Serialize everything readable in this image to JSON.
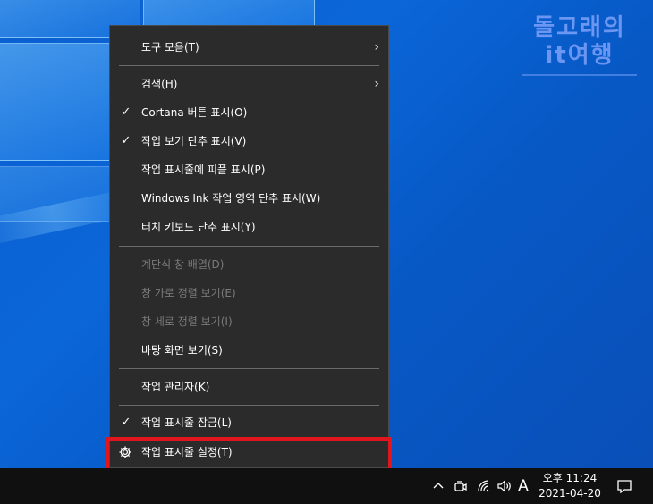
{
  "desktop": {
    "watermark_line1": "돌고래의",
    "watermark_line2": "it여행"
  },
  "menu": {
    "items": [
      {
        "label": "도구 모음(T)",
        "checked": false,
        "submenu": true,
        "disabled": false
      },
      {
        "label": "검색(H)",
        "checked": false,
        "submenu": true,
        "disabled": false
      },
      {
        "label": "Cortana 버튼 표시(O)",
        "checked": true,
        "submenu": false,
        "disabled": false
      },
      {
        "label": "작업 보기 단추 표시(V)",
        "checked": true,
        "submenu": false,
        "disabled": false
      },
      {
        "label": "작업 표시줄에 피플 표시(P)",
        "checked": false,
        "submenu": false,
        "disabled": false
      },
      {
        "label": "Windows Ink 작업 영역 단추 표시(W)",
        "checked": false,
        "submenu": false,
        "disabled": false
      },
      {
        "label": "터치 키보드 단추 표시(Y)",
        "checked": false,
        "submenu": false,
        "disabled": false
      },
      {
        "label": "계단식 창 배열(D)",
        "checked": false,
        "submenu": false,
        "disabled": true
      },
      {
        "label": "창 가로 정렬 보기(E)",
        "checked": false,
        "submenu": false,
        "disabled": true
      },
      {
        "label": "창 세로 정렬 보기(I)",
        "checked": false,
        "submenu": false,
        "disabled": true
      },
      {
        "label": "바탕 화면 보기(S)",
        "checked": false,
        "submenu": false,
        "disabled": false
      },
      {
        "label": "작업 관리자(K)",
        "checked": false,
        "submenu": false,
        "disabled": false
      },
      {
        "label": "작업 표시줄 잠금(L)",
        "checked": true,
        "submenu": false,
        "disabled": false
      },
      {
        "label": "작업 표시줄 설정(T)",
        "checked": false,
        "submenu": false,
        "disabled": false,
        "icon": "gear-icon"
      }
    ],
    "check_glyph": "✓",
    "arrow_glyph": "›"
  },
  "taskbar": {
    "tray": {
      "chevron_icon": "chevron-up-icon",
      "meet_icon": "meet-now-icon",
      "wifi_icon": "wifi-icon",
      "volume_icon": "volume-icon",
      "ime_label": "A"
    },
    "clock": {
      "time": "오후 11:24",
      "date": "2021-04-20"
    },
    "notification_icon": "notification-icon"
  },
  "colors": {
    "desktop_blue": "#0a5fd0",
    "menu_bg": "#2b2b2b",
    "menu_text": "#ffffff",
    "menu_disabled_text": "#7a7a7a",
    "taskbar_bg": "#101010",
    "highlight_red": "#e0161e"
  }
}
